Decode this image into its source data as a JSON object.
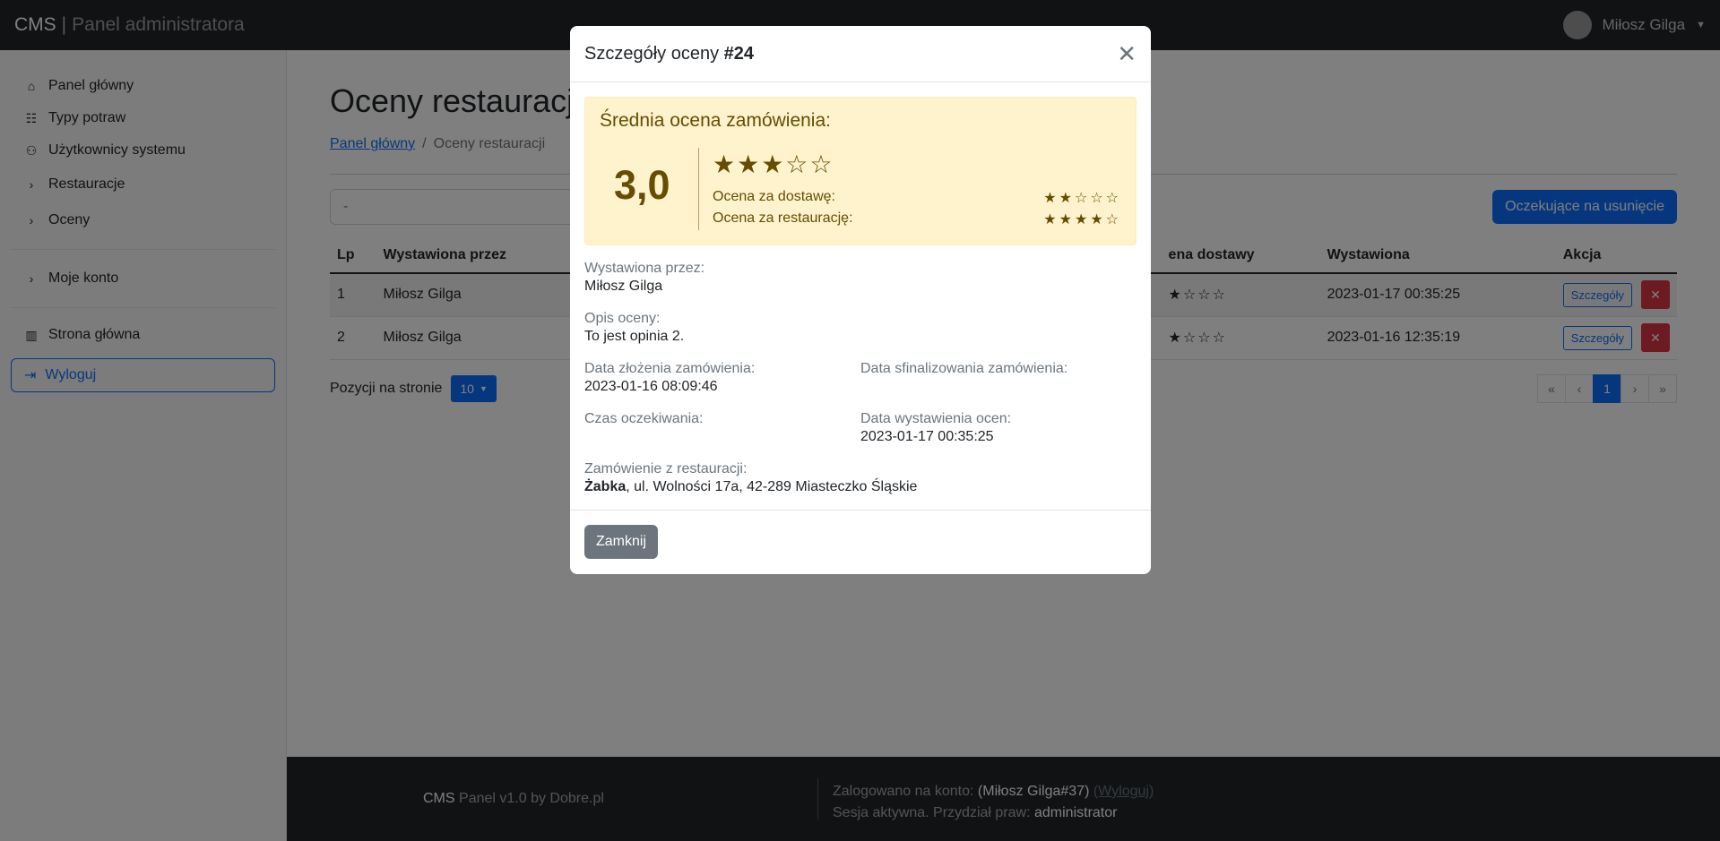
{
  "topbar": {
    "brand": "CMS",
    "brand_sub": "Panel administratora",
    "user": "Miłosz Gilga"
  },
  "sidebar": {
    "items": [
      {
        "label": "Panel główny",
        "icon": "house-icon"
      },
      {
        "label": "Typy potraw",
        "icon": "food-cart-icon"
      },
      {
        "label": "Użytkownicy systemu",
        "icon": "users-icon"
      },
      {
        "label": "Restauracje",
        "icon": "chevron-right-icon"
      },
      {
        "label": "Oceny",
        "icon": "chevron-right-icon"
      },
      {
        "label": "Moje konto",
        "icon": "chevron-right-icon"
      },
      {
        "label": "Strona główna",
        "icon": "building-icon"
      }
    ],
    "logout": "Wyloguj"
  },
  "main": {
    "title": "Oceny restauracji",
    "breadcrumb": {
      "home": "Panel główny",
      "current": "Oceny restauracji"
    },
    "search_value": "-",
    "pending_button": "Oczekujące na usunięcie",
    "table": {
      "headers": [
        "Lp",
        "Wystawiona przez",
        "",
        "Ocena dostawy",
        "Wystawiona",
        "Akcja"
      ],
      "header_partial": "ena dostawy",
      "rows": [
        {
          "lp": "1",
          "by": "Miłosz Gilga",
          "stars": "★☆☆☆",
          "date": "2023-01-17 00:35:25",
          "details": "Szczegóły"
        },
        {
          "lp": "2",
          "by": "Miłosz Gilga",
          "stars": "★☆☆☆",
          "date": "2023-01-16 12:35:19",
          "details": "Szczegóły"
        }
      ]
    },
    "per_page_label": "Pozycji na stronie",
    "per_page_value": "10",
    "pager": {
      "first": "«",
      "prev": "‹",
      "page": "1",
      "next": "›",
      "last": "»"
    }
  },
  "footer": {
    "left_brand": "CMS",
    "left_rest": "Panel v1.0 by Dobre.pl",
    "logged_label": "Zalogowano na konto:",
    "logged_user": "(Miłosz Gilga#37)",
    "logout_link": "(Wyloguj)",
    "session_label": "Sesja aktywna. Przydział praw:",
    "role": "administrator"
  },
  "modal": {
    "title_prefix": "Szczegóły oceny",
    "title_id": "#24",
    "avg_title": "Średnia ocena zamówienia:",
    "avg_value": "3,0",
    "avg_stars": "★★★☆☆",
    "delivery_label": "Ocena za dostawę:",
    "delivery_stars": "★★☆☆☆",
    "restaurant_label": "Ocena za restaurację:",
    "restaurant_stars": "★★★★☆",
    "by_label": "Wystawiona przez:",
    "by_value": "Miłosz Gilga",
    "desc_label": "Opis oceny:",
    "desc_value": "To jest opinia 2.",
    "order_date_label": "Data złożenia zamówienia:",
    "order_date_value": "2023-01-16 08:09:46",
    "finalized_label": "Data sfinalizowania zamówienia:",
    "wait_label": "Czas oczekiwania:",
    "issued_label": "Data wystawienia ocen:",
    "issued_value": "2023-01-17 00:35:25",
    "restaurant_from_label": "Zamówienie z restauracji:",
    "restaurant_name": "Żabka",
    "restaurant_address": ", ul. Wolności 17a, 42-289 Miasteczko Śląskie",
    "close_button": "Zamknij"
  }
}
